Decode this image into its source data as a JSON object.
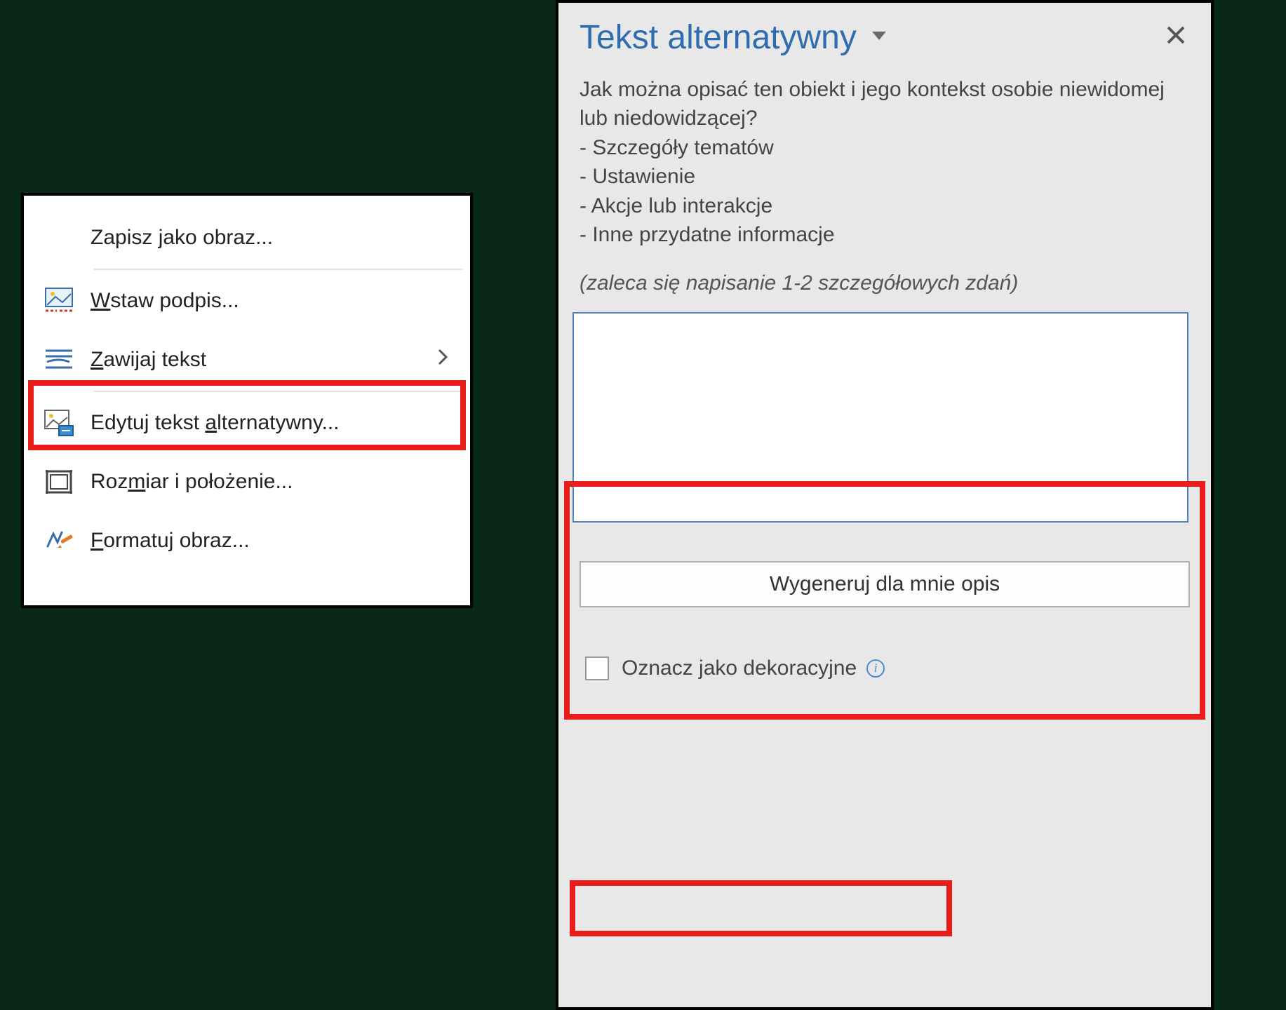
{
  "context_menu": {
    "items": [
      {
        "label": "Zapisz jako obraz...",
        "underline_index": null,
        "icon": null,
        "has_submenu": false
      },
      {
        "label": "Wstaw podpis...",
        "underline_index": 0,
        "icon": "picture-icon-red",
        "has_submenu": false
      },
      {
        "label": "Zawijaj tekst",
        "underline_index": 0,
        "icon": "wrap-text-icon",
        "has_submenu": true
      },
      {
        "label": "Edytuj tekst alternatywny...",
        "underline_index": 13,
        "icon": "alt-text-icon",
        "has_submenu": false
      },
      {
        "label": "Rozmiar i położenie...",
        "underline_index": 3,
        "icon": "size-position-icon",
        "has_submenu": false
      },
      {
        "label": "Formatuj obraz...",
        "underline_index": 0,
        "icon": "format-picture-icon",
        "has_submenu": false
      }
    ]
  },
  "alt_panel": {
    "title": "Tekst alternatywny",
    "hint_intro": "Jak można opisać ten obiekt i jego kontekst osobie niewidomej lub niedowidzącej?",
    "hint_bullets": [
      "- Szczegóły tematów",
      "- Ustawienie",
      "- Akcje lub interakcje",
      "- Inne przydatne informacje"
    ],
    "recommend": "(zaleca się napisanie 1-2 szczegółowych zdań)",
    "textarea_value": "",
    "generate_label": "Wygeneruj dla mnie opis",
    "decorative_label": "Oznacz jako dekoracyjne"
  },
  "colors": {
    "highlight": "#ea1d1d",
    "accent": "#2e6cb0",
    "panel_bg": "#e8e8e8"
  }
}
